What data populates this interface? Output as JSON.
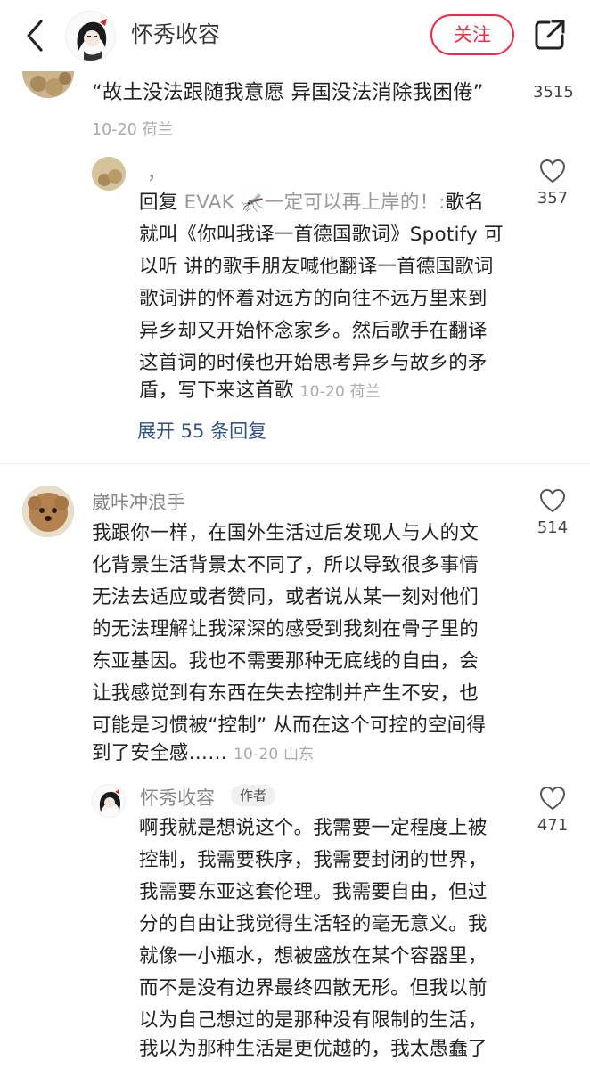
{
  "header": {
    "author_name": "怀秀收容",
    "follow_label": "关注"
  },
  "top_comment": {
    "text": "“故土没法跟随我意愿 异国没法消除我困倦”",
    "meta": "10-20 荷兰",
    "likes": "3515",
    "reply": {
      "username": "，",
      "reply_prefix": "回复 ",
      "reply_target": "EVAK 🦟一定可以再上岸的！:",
      "lines": [
        "歌名",
        "就叫《你叫我译一首德国歌词》Spotify 可",
        "以听 讲的歌手朋友喊他翻译一首德国歌词",
        "歌词讲的怀着对远方的向往不远万里来到",
        "异乡却又开始怀念家乡。然后歌手在翻译",
        "这首词的时候也开始思考异乡与故乡的矛",
        "盾，写下来这首歌"
      ],
      "meta": "10-20 荷兰",
      "likes": "357",
      "expand_label": "展开 55 条回复"
    }
  },
  "comment2": {
    "username": "崴咔冲浪手",
    "lines": [
      "我跟你一样，在国外生活过后发现人与人的文",
      "化背景生活背景太不同了，所以导致很多事情",
      "无法去适应或者赞同，或者说从某一刻对他们",
      "的无法理解让我深深的感受到我刻在骨子里的",
      "东亚基因。我也不需要那种无底线的自由，会",
      "让我感觉到有东西在失去控制并产生不安，也",
      "可能是习惯被“控制” 从而在这个可控的空间得",
      "到了安全感……"
    ],
    "meta": "10-20 山东",
    "likes": "514",
    "reply": {
      "username": "怀秀收容",
      "badge": "作者",
      "lines": [
        "啊我就是想说这个。我需要一定程度上被",
        "控制，我需要秩序，我需要封闭的世界，",
        "我需要东亚这套伦理。我需要自由，但过",
        "分的自由让我觉得生活轻的毫无意义。我",
        "就像一小瓶水，想被盛放在某个容器里，",
        "而不是没有边界最终四散无形。但我以前",
        "以为自己想过的是那种没有限制的生活，",
        "我以为那种生活是更优越的，我太愚蠢了"
      ],
      "likes": "471"
    }
  },
  "colors": {
    "accent": "#ff2442",
    "link": "#30528c",
    "meta": "#aaaaaa"
  }
}
